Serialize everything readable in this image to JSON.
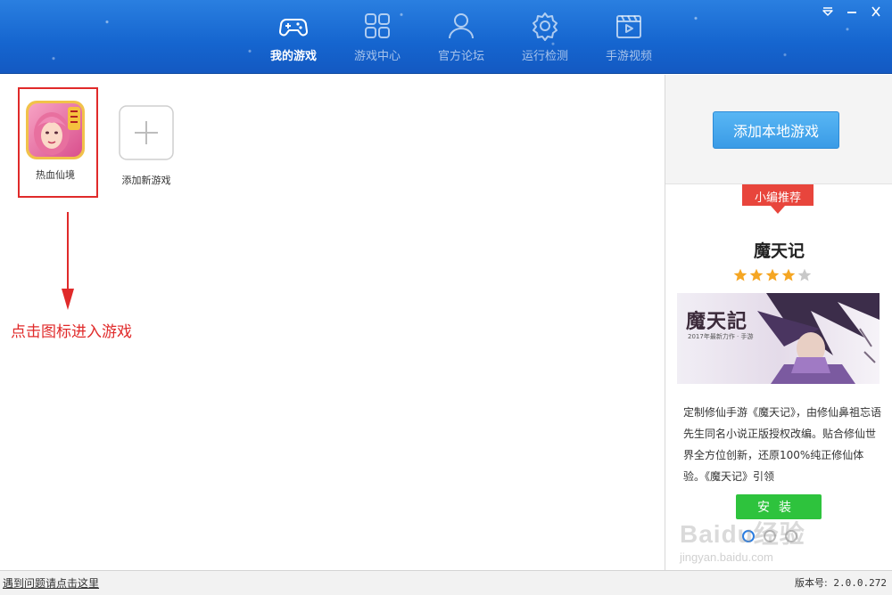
{
  "nav": {
    "items": [
      {
        "label": "我的游戏",
        "icon": "gamepad-icon",
        "active": true
      },
      {
        "label": "游戏中心",
        "icon": "grid-icon",
        "active": false
      },
      {
        "label": "官方论坛",
        "icon": "users-icon",
        "active": false
      },
      {
        "label": "运行检测",
        "icon": "gear-icon",
        "active": false
      },
      {
        "label": "手游视频",
        "icon": "video-icon",
        "active": false
      }
    ]
  },
  "window_controls": [
    "menu-down-icon",
    "minimize-icon",
    "close-icon"
  ],
  "my_games": {
    "games": [
      {
        "label": "热血仙境",
        "icon": "game-avatar-icon"
      }
    ],
    "add_tile_label": "添加新游戏"
  },
  "annotation": {
    "text": "点击图标进入游戏",
    "color": "#e02a2a"
  },
  "sidebar": {
    "add_local_button": "添加本地游戏",
    "recommend": {
      "ribbon_label": "小编推荐",
      "game_title": "魔天记",
      "rating": 4,
      "rating_max": 5,
      "banner_title": "魔天記",
      "banner_subtitle": "2017年最新力作 · 手游",
      "description": "定制修仙手游《魔天记》，由修仙鼻祖忘语先生同名小说正版授权改编。贴合修仙世界全方位创新，还原100%纯正修仙体验。《魔天记》引领",
      "install_button": "安装",
      "pager_count": 3,
      "pager_active": 0
    }
  },
  "watermark": {
    "text": "Baidu经验",
    "sub": "jingyan.baidu.com"
  },
  "statusbar": {
    "help_link": "遇到问题请点击这里",
    "version_label": "版本号:",
    "version_value": "2.0.0.272"
  },
  "colors": {
    "header": "#1a6bd6",
    "accent": "#3a9be6",
    "install": "#2ec33d",
    "ribbon": "#e8453c",
    "star": "#f5a623"
  }
}
